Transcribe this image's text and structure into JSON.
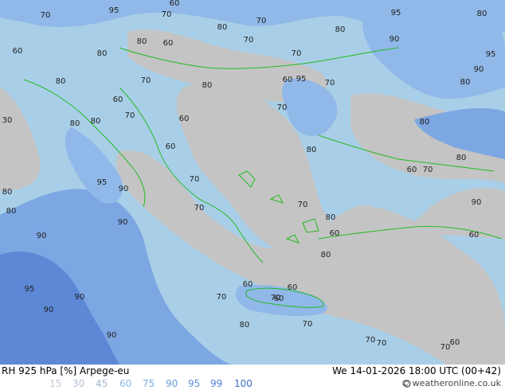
{
  "title": "RH 925 hPa [%] Arpege-eu",
  "datetime": "We 14-01-2026 18:00 UTC (00+42)",
  "credit": "© weatheronline.co.uk",
  "legend": [
    {
      "label": "15",
      "color": "#c0c8d6"
    },
    {
      "label": "30",
      "color": "#b2bed0"
    },
    {
      "label": "45",
      "color": "#a6b8cf"
    },
    {
      "label": "60",
      "color": "#8fb8e8"
    },
    {
      "label": "75",
      "color": "#78a8e0"
    },
    {
      "label": "90",
      "color": "#6c9cdc"
    },
    {
      "label": "95",
      "color": "#5f8fd6"
    },
    {
      "label": "99",
      "color": "#4e7fd0"
    },
    {
      "label": "100",
      "color": "#3d6dc4"
    }
  ],
  "colors": {
    "dry_gray": "#c4c4c4",
    "mid_blue": "#a9cfe8",
    "moist_blue": "#90b8e8",
    "wet_blue": "#7da7e3",
    "very_wet": "#5c88d6",
    "coastline": "#22bb22"
  },
  "contour_labels": [
    "95",
    "60",
    "70",
    "70",
    "95",
    "80",
    "80",
    "70",
    "70",
    "60",
    "80",
    "80",
    "70",
    "60",
    "80",
    "70",
    "80",
    "60",
    "95",
    "90",
    "90",
    "80",
    "70",
    "60",
    "60",
    "80",
    "90",
    "70",
    "30",
    "80",
    "70",
    "80",
    "60",
    "80",
    "60",
    "70",
    "80",
    "90",
    "95",
    "80",
    "60",
    "70",
    "80",
    "90",
    "60",
    "90",
    "80",
    "80",
    "60",
    "90",
    "60",
    "95",
    "90",
    "70",
    "60",
    "70",
    "70",
    "95",
    "80",
    "90",
    "70",
    "80",
    "70",
    "70",
    "70",
    "70",
    "60"
  ]
}
